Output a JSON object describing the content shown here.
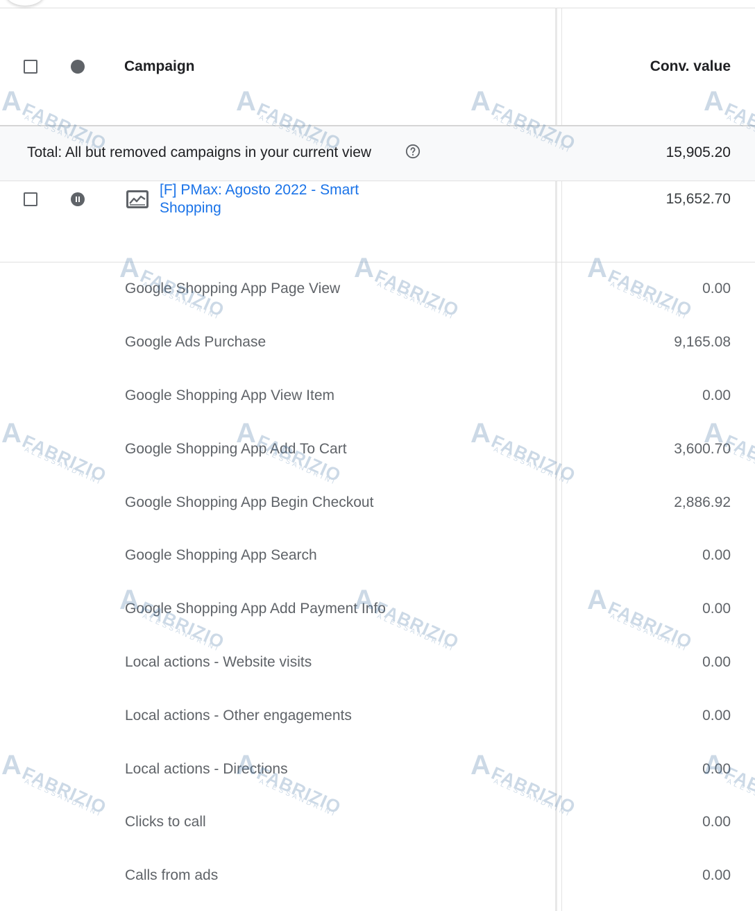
{
  "header": {
    "campaign_col": "Campaign",
    "value_col": "Conv. value"
  },
  "total": {
    "label": "Total: All but removed campaigns in your current view",
    "value": "15,905.20"
  },
  "campaign": {
    "name": "[F] PMax: Agosto 2022 - Smart Shopping",
    "value": "15,652.70",
    "status": "paused"
  },
  "conversions": [
    {
      "name": "Google Shopping App Page View",
      "value": "0.00"
    },
    {
      "name": "Google Ads Purchase",
      "value": "9,165.08"
    },
    {
      "name": "Google Shopping App View Item",
      "value": "0.00"
    },
    {
      "name": "Google Shopping App Add To Cart",
      "value": "3,600.70"
    },
    {
      "name": "Google Shopping App Begin Checkout",
      "value": "2,886.92"
    },
    {
      "name": "Google Shopping App Search",
      "value": "0.00"
    },
    {
      "name": "Google Shopping App Add Payment Info",
      "value": "0.00"
    },
    {
      "name": "Local actions - Website visits",
      "value": "0.00"
    },
    {
      "name": "Local actions - Other engagements",
      "value": "0.00"
    },
    {
      "name": "Local actions - Directions",
      "value": "0.00"
    },
    {
      "name": "Clicks to call",
      "value": "0.00"
    },
    {
      "name": "Calls from ads",
      "value": "0.00"
    }
  ],
  "watermark": {
    "glyph": "A",
    "name": "FABRIZIO",
    "surname": "ALESSANDRINI"
  },
  "colors": {
    "link": "#1a73e8",
    "watermark": "#4a79a8"
  }
}
